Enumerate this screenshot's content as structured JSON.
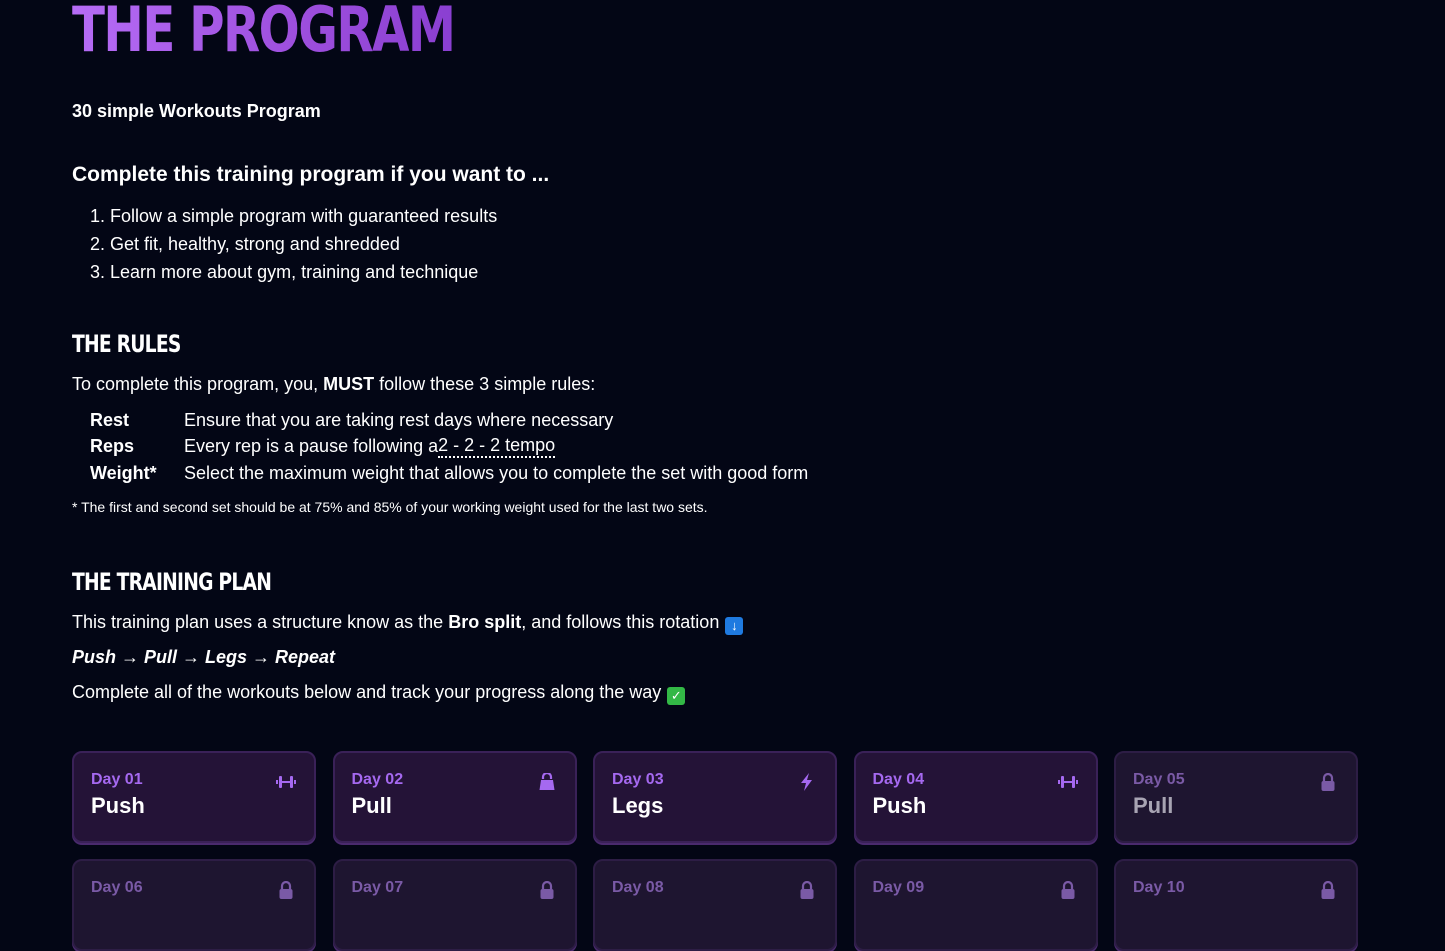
{
  "header": {
    "title": "THE PROGRAM",
    "subtitle": "30 simple Workouts Program"
  },
  "goals": {
    "heading": "Complete this training program if you want to ...",
    "items": [
      "1. Follow a simple program with guaranteed results",
      "2. Get fit, healthy, strong and shredded",
      "3. Learn more about gym, training and technique"
    ]
  },
  "rules": {
    "title": "THE RULES",
    "intro_pre": "To complete this program, you, ",
    "intro_bold": "MUST",
    "intro_post": " follow these 3 simple rules:",
    "items": [
      {
        "name": "Rest",
        "text": "Ensure that you are taking rest days where necessary"
      },
      {
        "name": "Reps",
        "text_pre": "Every rep is a pause following a ",
        "text_link": "2 - 2 - 2 tempo"
      },
      {
        "name": "Weight*",
        "text": "Select the maximum weight that allows you to complete the set with good form"
      }
    ],
    "footnote": "* The first and second set should be at 75% and 85% of your working weight used for the last two sets."
  },
  "plan": {
    "title": "THE TRAINING PLAN",
    "intro_pre": "This training plan uses a structure know as the ",
    "intro_bold": "Bro split",
    "intro_post": ", and follows this rotation",
    "rotation": "Push → Pull → Legs → Repeat",
    "track": "Complete all of the workouts below and track your progress along the way"
  },
  "icons": {
    "down_emoji": "down-arrow-emoji",
    "check_emoji": "check-mark-emoji"
  },
  "colors": {
    "background": "#030615",
    "accent": "#9d4edd",
    "card": "#241337"
  },
  "workouts": [
    {
      "day": "Day 01",
      "name": "Push",
      "icon": "dumbbell-icon",
      "locked": false
    },
    {
      "day": "Day 02",
      "name": "Pull",
      "icon": "kettlebell-icon",
      "locked": false
    },
    {
      "day": "Day 03",
      "name": "Legs",
      "icon": "bolt-icon",
      "locked": false
    },
    {
      "day": "Day 04",
      "name": "Push",
      "icon": "dumbbell-icon",
      "locked": false
    },
    {
      "day": "Day 05",
      "name": "Pull",
      "icon": "lock-icon",
      "locked": true
    },
    {
      "day": "Day 06",
      "name": "",
      "icon": "lock-icon",
      "locked": true
    },
    {
      "day": "Day 07",
      "name": "",
      "icon": "lock-icon",
      "locked": true
    },
    {
      "day": "Day 08",
      "name": "",
      "icon": "lock-icon",
      "locked": true
    },
    {
      "day": "Day 09",
      "name": "",
      "icon": "lock-icon",
      "locked": true
    },
    {
      "day": "Day 10",
      "name": "",
      "icon": "lock-icon",
      "locked": true
    }
  ]
}
